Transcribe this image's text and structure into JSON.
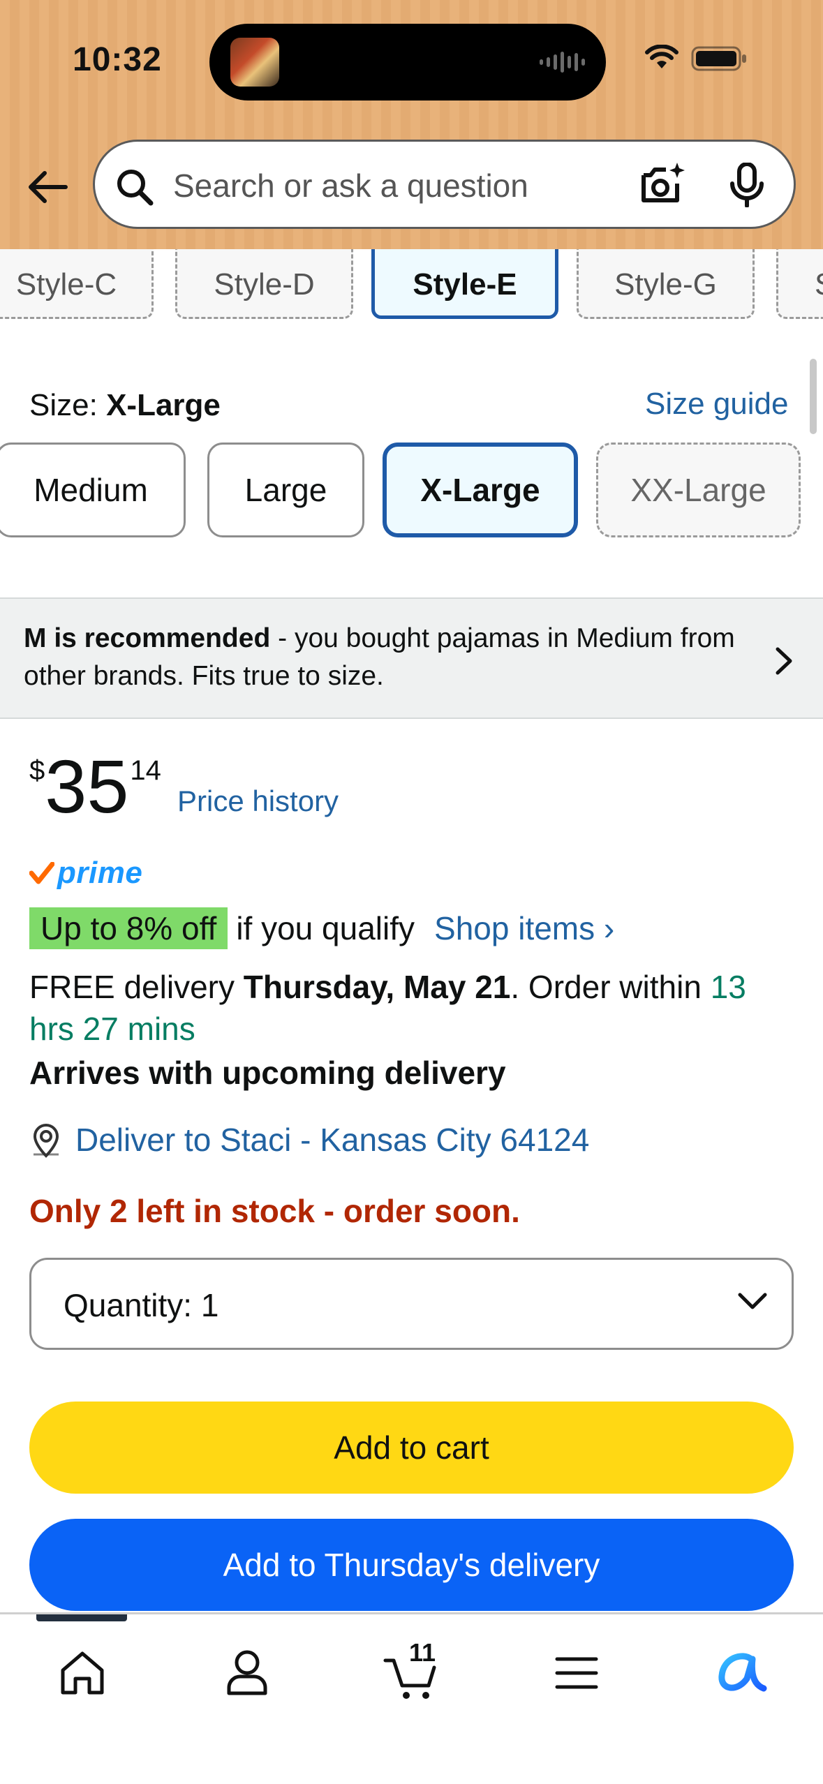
{
  "status_bar": {
    "time": "10:32"
  },
  "search": {
    "placeholder": "Search or ask a question"
  },
  "style_options": [
    "Style-C",
    "Style-D",
    "Style-E",
    "Style-G",
    "S"
  ],
  "style_selected": "Style-E",
  "size": {
    "label": "Size:",
    "selected": "X-Large",
    "guide_label": "Size guide",
    "options": [
      "Medium",
      "Large",
      "X-Large",
      "XX-Large"
    ]
  },
  "recommendation": {
    "bold": "M is recommended",
    "text": " - you bought pajamas in Medium from other brands. Fits true to size."
  },
  "price": {
    "symbol": "$",
    "whole": "35",
    "fraction": "14",
    "history_label": "Price history"
  },
  "prime": {
    "label": "prime"
  },
  "discount": {
    "badge": "Up to 8% off",
    "qualify_text": "if you qualify",
    "shop_label": "Shop items ›"
  },
  "delivery": {
    "prefix": "FREE delivery ",
    "date": "Thursday, May 21",
    "middle": ". Order within ",
    "countdown": "13 hrs 27 mins",
    "upcoming": "Arrives with upcoming delivery"
  },
  "location": {
    "text": "Deliver to Staci - Kansas City 64124"
  },
  "stock": {
    "text": "Only 2 left in stock - order soon."
  },
  "quantity": {
    "text": "Quantity:  1"
  },
  "buttons": {
    "add_to_cart": "Add to cart",
    "add_to_delivery": "Add to Thursday's delivery"
  },
  "nav": {
    "cart_count": "11",
    "items": [
      "home-icon",
      "account-icon",
      "cart-icon",
      "menu-icon",
      "rufus-icon"
    ]
  },
  "colors": {
    "accent_link": "#2162a1",
    "add_to_cart": "#ffd814",
    "add_to_delivery": "#0a63f6",
    "stock_warning": "#b12704",
    "header_bg": "#e8b27a"
  }
}
